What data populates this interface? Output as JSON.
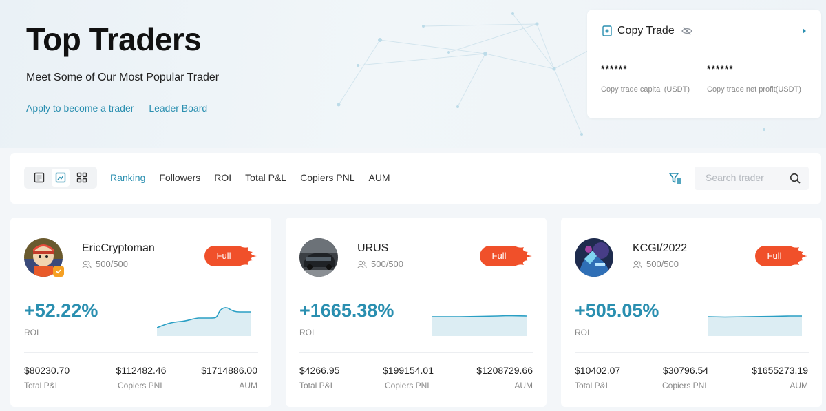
{
  "hero": {
    "title": "Top Traders",
    "subtitle": "Meet Some of Our Most Popular Trader",
    "links": [
      "Apply to become a trader",
      "Leader Board"
    ]
  },
  "copy_trade": {
    "title": "Copy Trade",
    "capital_value": "******",
    "capital_label": "Copy trade capital (USDT)",
    "profit_value": "******",
    "profit_label": "Copy trade net profit(USDT)"
  },
  "toolbar": {
    "view_icons": [
      "list-view-icon",
      "chart-view-icon",
      "grid-view-icon"
    ],
    "sort_tabs": [
      "Ranking",
      "Followers",
      "ROI",
      "Total P&L",
      "Copiers PNL",
      "AUM"
    ],
    "active_tab": "Ranking",
    "search_placeholder": "Search trader"
  },
  "colors": {
    "accent": "#2a8fb0",
    "badge": "#f0502a"
  },
  "traders": [
    {
      "name": "EricCryptoman",
      "followers": "500/500",
      "badge": "Full",
      "roi": "+52.22%",
      "roi_label": "ROI",
      "total_pnl": "$80230.70",
      "total_pnl_label": "Total P&L",
      "copiers_pnl": "$112482.46",
      "copiers_pnl_label": "Copiers PNL",
      "aum": "$1714886.00",
      "aum_label": "AUM"
    },
    {
      "name": "URUS",
      "followers": "500/500",
      "badge": "Full",
      "roi": "+1665.38%",
      "roi_label": "ROI",
      "total_pnl": "$4266.95",
      "total_pnl_label": "Total P&L",
      "copiers_pnl": "$199154.01",
      "copiers_pnl_label": "Copiers PNL",
      "aum": "$1208729.66",
      "aum_label": "AUM"
    },
    {
      "name": "KCGI/2022",
      "followers": "500/500",
      "badge": "Full",
      "roi": "+505.05%",
      "roi_label": "ROI",
      "total_pnl": "$10402.07",
      "total_pnl_label": "Total P&L",
      "copiers_pnl": "$30796.54",
      "copiers_pnl_label": "Copiers PNL",
      "aum": "$1655273.19",
      "aum_label": "AUM"
    }
  ]
}
